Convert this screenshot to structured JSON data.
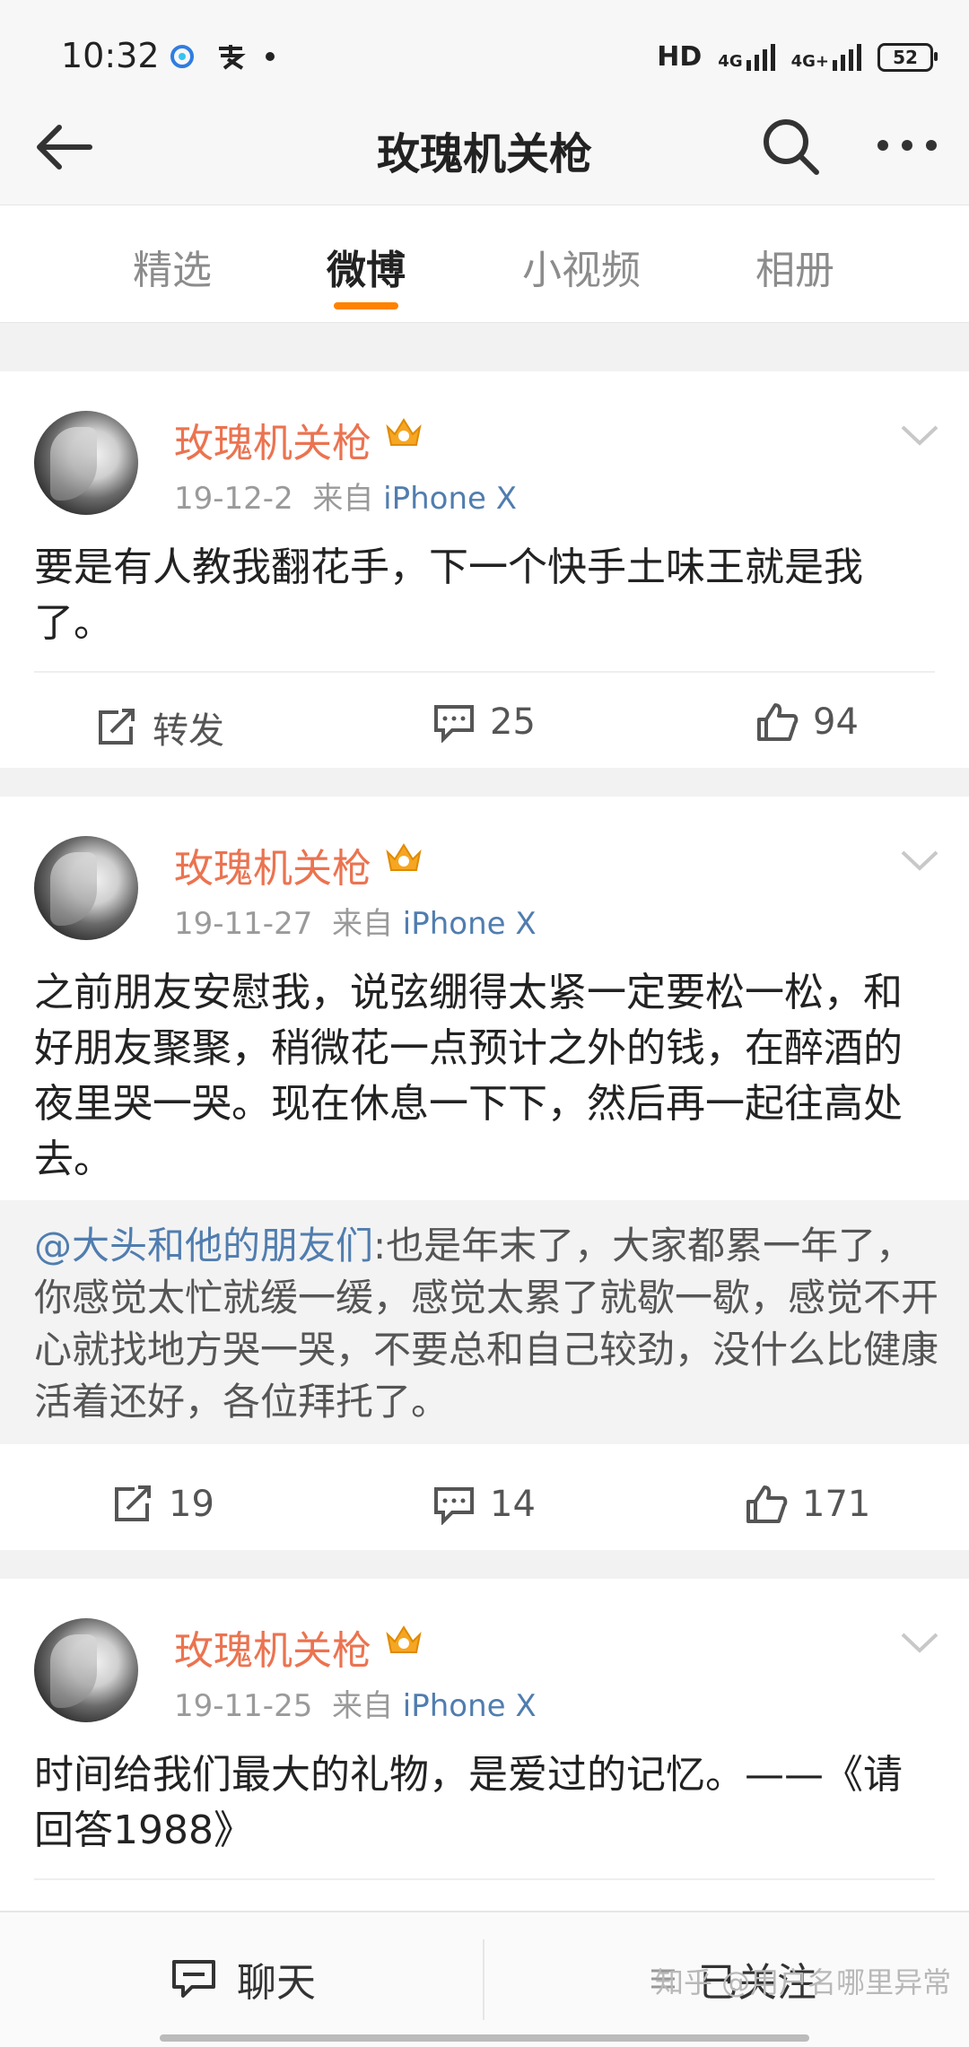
{
  "status": {
    "time": "10:32",
    "network": "HD",
    "signal1": "4G",
    "signal2": "4G+",
    "battery": "52"
  },
  "nav": {
    "title": "玫瑰机关枪"
  },
  "tabs": [
    "精选",
    "微博",
    "小视频",
    "相册"
  ],
  "active_tab": "微博",
  "posts": [
    {
      "author": "玫瑰机关枪",
      "date": "19-12-2",
      "source_prefix": "来自",
      "source": "iPhone X",
      "text": "要是有人教我翻花手，下一个快手土味王就是我了。",
      "repost_label": "转发",
      "comments": "25",
      "likes": "94"
    },
    {
      "author": "玫瑰机关枪",
      "date": "19-11-27",
      "source_prefix": "来自",
      "source": "iPhone X",
      "text": "之前朋友安慰我，说弦绷得太紧一定要松一松，和好朋友聚聚，稍微花一点预计之外的钱，在醉酒的夜里哭一哭。现在休息一下下，然后再一起往高处去。",
      "repost": {
        "mention": "@大头和他的朋友们",
        "text": ":也是年末了，大家都累一年了，你感觉太忙就缓一缓，感觉太累了就歇一歇，感觉不开心就找地方哭一哭，不要总和自己较劲，没什么比健康活着还好，各位拜托了。"
      },
      "reposts": "19",
      "comments": "14",
      "likes": "171"
    },
    {
      "author": "玫瑰机关枪",
      "date": "19-11-25",
      "source_prefix": "来自",
      "source": "iPhone X",
      "text": "时间给我们最大的礼物，是爱过的记忆。——《请回答1988》"
    }
  ],
  "bottom": {
    "chat": "聊天",
    "followed": "已关注"
  },
  "watermark": "知乎 @用户名哪里异常",
  "colors": {
    "accent": "#ff8200",
    "name": "#eb7350",
    "link": "#507daf"
  }
}
